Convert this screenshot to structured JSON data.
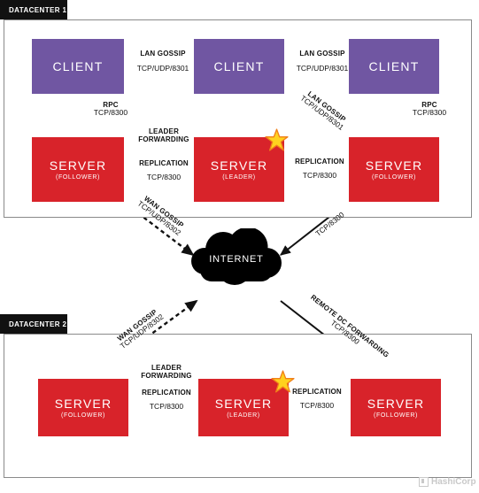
{
  "diagram": {
    "title": "Consul Architecture",
    "colors": {
      "client": "#7056a2",
      "server": "#d8232a",
      "cloud": "#000000",
      "star": "#ffd21e",
      "star_outline": "#f0801a",
      "frame": "#8a8a8a",
      "tab": "#111111",
      "logo": "#c9c9c9"
    }
  },
  "datacenter1": {
    "label": "DATACENTER 1",
    "nodes": [
      {
        "title": "CLIENT",
        "role": ""
      },
      {
        "title": "CLIENT",
        "role": ""
      },
      {
        "title": "CLIENT",
        "role": ""
      },
      {
        "title": "SERVER",
        "role": "(FOLLOWER)"
      },
      {
        "title": "SERVER",
        "role": "(LEADER)"
      },
      {
        "title": "SERVER",
        "role": "(FOLLOWER)"
      }
    ],
    "edges": [
      {
        "name": "LAN GOSSIP",
        "port": "TCP/UDP/8301"
      },
      {
        "name": "LAN GOSSIP",
        "port": "TCP/UDP/8301"
      },
      {
        "name": "LAN GOSSIP",
        "port": "TCP/UDP/8301"
      },
      {
        "name": "RPC",
        "port": "TCP/8300"
      },
      {
        "name": "RPC",
        "port": "TCP/8300"
      },
      {
        "name": "LEADER FORWARDING",
        "name_line1": "LEADER",
        "name_line2": "FORWARDING",
        "port": ""
      },
      {
        "name": "REPLICATION",
        "port": "TCP/8300"
      },
      {
        "name": "REPLICATION",
        "port": "TCP/8300"
      },
      {
        "name": "WAN GOSSIP",
        "port": "TCP/UDP/8302"
      },
      {
        "name": "",
        "port": "TCP/8300"
      }
    ]
  },
  "datacenter2": {
    "label": "DATACENTER 2",
    "nodes": [
      {
        "title": "SERVER",
        "role": "(FOLLOWER)"
      },
      {
        "title": "SERVER",
        "role": "(LEADER)"
      },
      {
        "title": "SERVER",
        "role": "(FOLLOWER)"
      }
    ],
    "edges": [
      {
        "name_line1": "LEADER",
        "name_line2": "FORWARDING",
        "port": ""
      },
      {
        "name": "REPLICATION",
        "port": "TCP/8300"
      },
      {
        "name": "REPLICATION",
        "port": "TCP/8300"
      },
      {
        "name": "WAN GOSSIP",
        "port": "TCP/UDP/8302"
      },
      {
        "name": "REMOTE DC FORWARDING",
        "port": "TCP/8300"
      }
    ]
  },
  "internet": {
    "label": "INTERNET"
  },
  "footer": {
    "logo_text": "HashiCorp",
    "logo_icon": "hashicorp-logo-icon"
  }
}
